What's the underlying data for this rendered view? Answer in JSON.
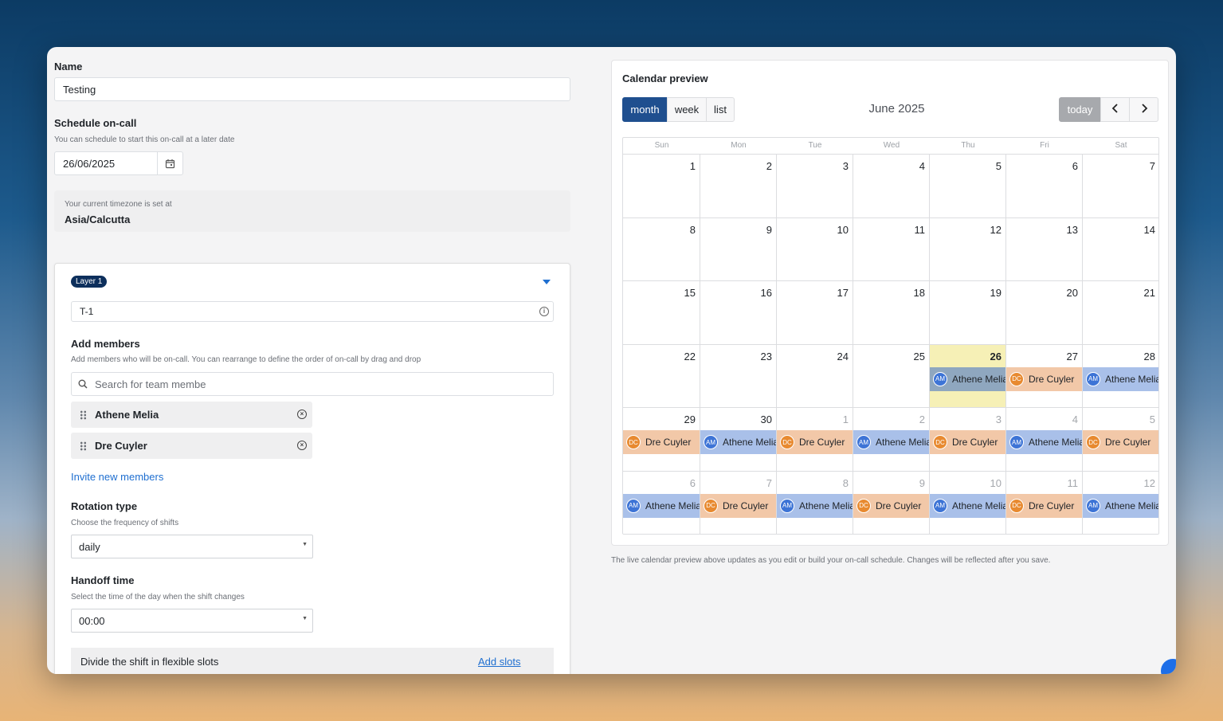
{
  "form": {
    "name_label": "Name",
    "name_value": "Testing",
    "schedule_label": "Schedule on-call",
    "schedule_hint": "You can schedule to start this on-call at a later date",
    "date_value": "26/06/2025",
    "tz_hint": "Your current timezone is set at",
    "tz_value": "Asia/Calcutta"
  },
  "layer": {
    "badge": "Layer 1",
    "name_value": "T-1",
    "members_label": "Add members",
    "members_hint": "Add members who will be on-call. You can rearrange to define the order of on-call by drag and drop",
    "search_placeholder": "Search for team membe",
    "members": [
      "Athene Melia",
      "Dre Cuyler"
    ],
    "invite_link": "Invite new members",
    "rotation_label": "Rotation type",
    "rotation_hint": "Choose the frequency of shifts",
    "rotation_value": "daily",
    "handoff_label": "Handoff time",
    "handoff_hint": "Select the time of the day when the shift changes",
    "handoff_value": "00:00",
    "slots_label": "Divide the shift in flexible slots",
    "slots_link": "Add slots"
  },
  "calendar": {
    "title": "Calendar preview",
    "views": [
      "month",
      "week",
      "list"
    ],
    "active_view": "month",
    "month_title": "June 2025",
    "today_label": "today",
    "prev_icon": "chevron-left-icon",
    "next_icon": "chevron-right-icon",
    "weekdays": [
      "Sun",
      "Mon",
      "Tue",
      "Wed",
      "Thu",
      "Fri",
      "Sat"
    ],
    "weeks": [
      [
        "1",
        "2",
        "3",
        "4",
        "5",
        "6",
        "7"
      ],
      [
        "8",
        "9",
        "10",
        "11",
        "12",
        "13",
        "14"
      ],
      [
        "15",
        "16",
        "17",
        "18",
        "19",
        "20",
        "21"
      ],
      [
        "22",
        "23",
        "24",
        "25",
        "26",
        "27",
        "28"
      ],
      [
        "29",
        "30",
        "1",
        "2",
        "3",
        "4",
        "5"
      ],
      [
        "6",
        "7",
        "8",
        "9",
        "10",
        "11",
        "12"
      ]
    ],
    "today_date": "26",
    "events": {
      "week4": [
        null,
        null,
        null,
        null,
        "AM",
        "DC",
        "AM"
      ],
      "week5": [
        "DC",
        "AM",
        "DC",
        "AM",
        "DC",
        "AM",
        "DC"
      ],
      "week6": [
        "AM",
        "DC",
        "AM",
        "DC",
        "AM",
        "DC",
        "AM"
      ]
    },
    "people": {
      "AM": {
        "initials": "AM",
        "name": "Athene Melia"
      },
      "DC": {
        "initials": "DC",
        "name": "Dre Cuyler"
      }
    },
    "colors": {
      "am_avatar": "#3d74d6",
      "dc_avatar": "#e88a30",
      "am_bg": "#a9c0e9",
      "dc_bg": "#f2c8a8",
      "active_view": "#1f4f8f",
      "today_bg": "#f6f0b6"
    },
    "footnote": "The live calendar preview above updates as you edit or build your on-call schedule. Changes will be reflected after you save."
  }
}
